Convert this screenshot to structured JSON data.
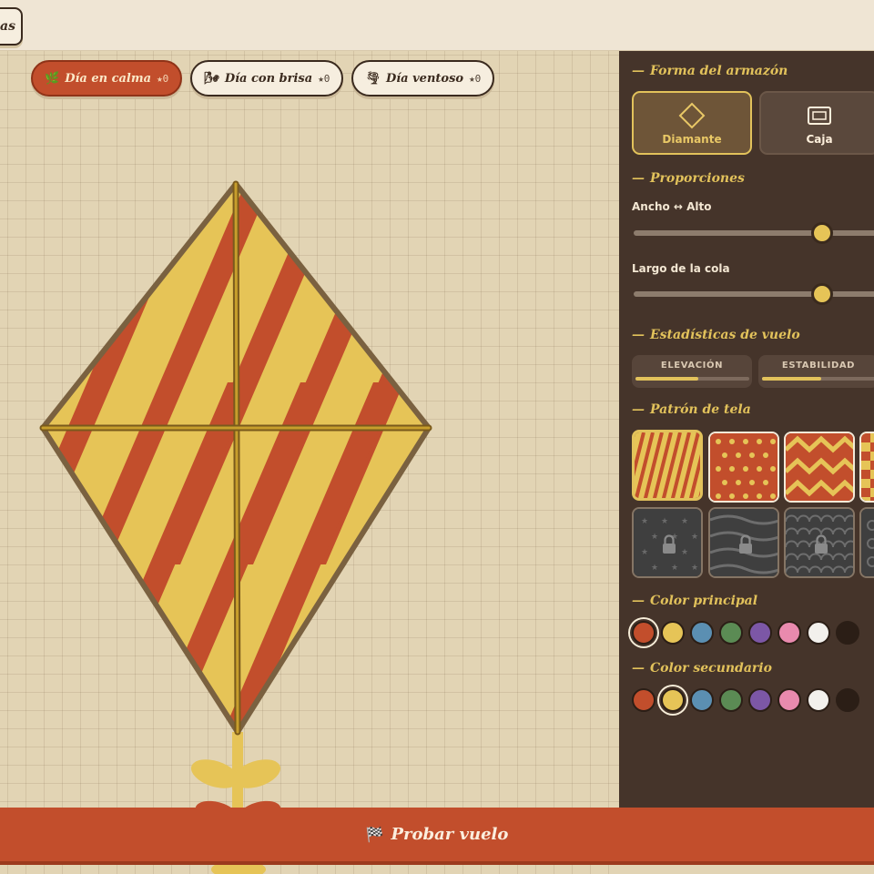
{
  "topbar": {
    "tab_label": "as"
  },
  "weather": [
    {
      "icon": "🌿",
      "label": "Día en calma",
      "stars": "★0",
      "active": true
    },
    {
      "icon": "🌬",
      "label": "Día con brisa",
      "stars": "★0",
      "active": false
    },
    {
      "icon": "🌪",
      "label": "Día ventoso",
      "stars": "★0",
      "active": false
    }
  ],
  "panel": {
    "frame": {
      "title": "Forma del armazón",
      "options": [
        {
          "label": "Diamante",
          "icon": "diamond-icon",
          "active": true
        },
        {
          "label": "Caja",
          "icon": "box-frame-icon",
          "active": false
        }
      ]
    },
    "proportions": {
      "title": "Proporciones",
      "ratio_label": "Ancho ↔ Alto",
      "ratio_value": 0.74,
      "tail_label": "Largo de la cola",
      "tail_value": 0.74
    },
    "stats": {
      "title": "Estadísticas de vuelo",
      "items": [
        {
          "label": "ELEVACIÓN",
          "value": 0.55
        },
        {
          "label": "ESTABILIDAD",
          "value": 0.52
        }
      ]
    },
    "fabric": {
      "title": "Patrón de tela",
      "patterns": [
        {
          "name": "stripes",
          "locked": false,
          "active": true
        },
        {
          "name": "dots",
          "locked": false,
          "active": false
        },
        {
          "name": "zigzag",
          "locked": false,
          "active": false
        },
        {
          "name": "checker",
          "locked": false,
          "active": false
        },
        {
          "name": "stars",
          "locked": true,
          "active": false
        },
        {
          "name": "waves",
          "locked": true,
          "active": false
        },
        {
          "name": "scales",
          "locked": true,
          "active": false
        },
        {
          "name": "circles",
          "locked": true,
          "active": false
        }
      ]
    },
    "primary_color": {
      "title": "Color principal",
      "swatches": [
        "#c24e2c",
        "#e6c457",
        "#5b8fb2",
        "#5b8b54",
        "#7c57a6",
        "#e98aae",
        "#f2f0ec",
        "#2b1e16"
      ],
      "selected": 0
    },
    "secondary_color": {
      "title": "Color secundario",
      "swatches": [
        "#c24e2c",
        "#e6c457",
        "#5b8fb2",
        "#5b8b54",
        "#7c57a6",
        "#e98aae",
        "#f2f0ec",
        "#2b1e16"
      ],
      "selected": 1
    }
  },
  "cta": {
    "icon": "🏁",
    "label": "Probar vuelo"
  },
  "kite": {
    "primary": "#e6c457",
    "secondary": "#c24e2c",
    "frame": "#7a6140",
    "spar": "#c79e2c"
  }
}
